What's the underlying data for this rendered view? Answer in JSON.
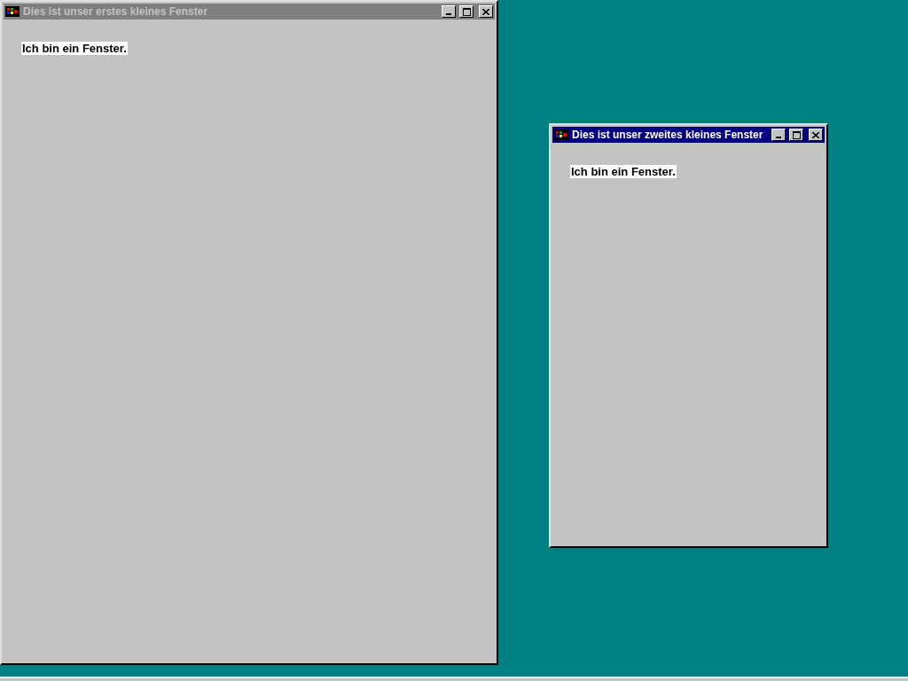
{
  "windows": [
    {
      "title": "Dies ist unser erstes kleines Fenster",
      "active": false,
      "label": "Ich bin ein Fenster."
    },
    {
      "title": "Dies ist unser zweites kleines Fenster",
      "active": true,
      "label": "Ich bin ein Fenster."
    }
  ]
}
